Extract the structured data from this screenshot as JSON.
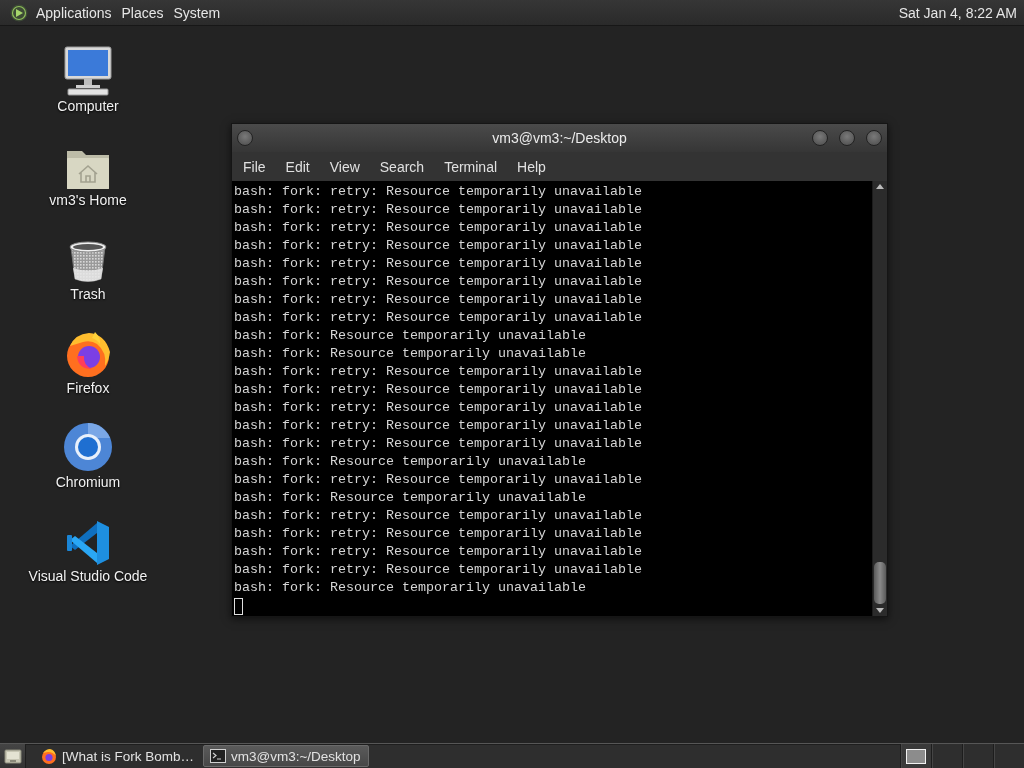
{
  "top_panel": {
    "menus": [
      "Applications",
      "Places",
      "System"
    ],
    "clock": "Sat Jan 4, 8:22 AM"
  },
  "desktop_icons": [
    {
      "label": "Computer",
      "kind": "monitor"
    },
    {
      "label": "vm3's Home",
      "kind": "home-folder"
    },
    {
      "label": "Trash",
      "kind": "trash"
    },
    {
      "label": "Firefox",
      "kind": "fox-browser"
    },
    {
      "label": "Chromium",
      "kind": "ring-browser"
    },
    {
      "label": "Visual Studio Code",
      "kind": "code-editor"
    }
  ],
  "terminal_window": {
    "title": "vm3@vm3:~/Desktop",
    "menu": [
      "File",
      "Edit",
      "View",
      "Search",
      "Terminal",
      "Help"
    ],
    "lines": [
      "bash: fork: retry: Resource temporarily unavailable",
      "bash: fork: retry: Resource temporarily unavailable",
      "bash: fork: retry: Resource temporarily unavailable",
      "bash: fork: retry: Resource temporarily unavailable",
      "bash: fork: retry: Resource temporarily unavailable",
      "bash: fork: retry: Resource temporarily unavailable",
      "bash: fork: retry: Resource temporarily unavailable",
      "bash: fork: retry: Resource temporarily unavailable",
      "bash: fork: Resource temporarily unavailable",
      "bash: fork: Resource temporarily unavailable",
      "bash: fork: retry: Resource temporarily unavailable",
      "bash: fork: retry: Resource temporarily unavailable",
      "bash: fork: retry: Resource temporarily unavailable",
      "bash: fork: retry: Resource temporarily unavailable",
      "bash: fork: retry: Resource temporarily unavailable",
      "bash: fork: Resource temporarily unavailable",
      "bash: fork: retry: Resource temporarily unavailable",
      "bash: fork: Resource temporarily unavailable",
      "bash: fork: retry: Resource temporarily unavailable",
      "bash: fork: retry: Resource temporarily unavailable",
      "bash: fork: retry: Resource temporarily unavailable",
      "bash: fork: retry: Resource temporarily unavailable",
      "bash: fork: Resource temporarily unavailable"
    ]
  },
  "taskbar": {
    "tasks": [
      {
        "label": "[What is Fork Bomb…",
        "kind": "browser",
        "selected": false
      },
      {
        "label": "vm3@vm3:~/Desktop",
        "kind": "terminal",
        "selected": true
      }
    ],
    "workspaces": [
      {
        "selected": true,
        "has_window": true
      },
      {
        "selected": false,
        "has_window": false
      },
      {
        "selected": false,
        "has_window": false
      },
      {
        "selected": false,
        "has_window": false
      }
    ]
  }
}
